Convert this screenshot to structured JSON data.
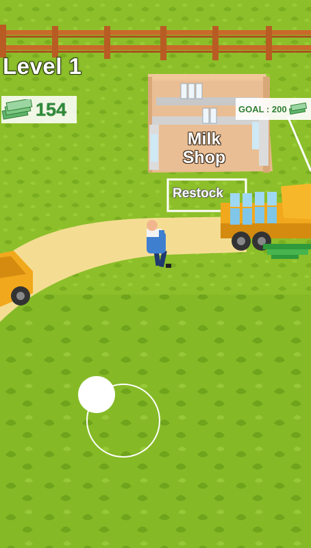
{
  "hud": {
    "level_label": "Level 1",
    "money_amount": "154",
    "money_icon": "cash-stack-icon"
  },
  "shop": {
    "name_line1": "Milk",
    "name_line2": "Shop",
    "goal_label": "GOAL : 200",
    "goal_icon": "cash-stack-icon"
  },
  "restock": {
    "label": "Restock"
  },
  "joystick": {
    "ring_icon": "joystick-ring",
    "knob_icon": "joystick-knob"
  },
  "colors": {
    "grass": "#8cbf2a",
    "path": "#f4dd93",
    "fence": "#c9692a",
    "truck": "#f2a81c",
    "money_text": "#2f8a3a"
  }
}
